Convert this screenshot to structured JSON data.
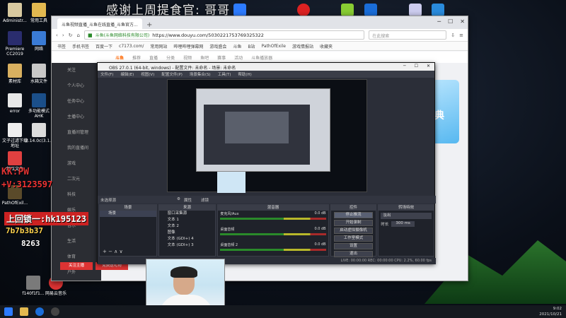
{
  "banner": "感谢上周提食官: 哥哥",
  "desktop": {
    "icons": [
      {
        "label": "Administr...",
        "color": "#d8c9a0"
      },
      {
        "label": "常用工具",
        "color": "#e3b950"
      },
      {
        "label": "Premiere CC2019",
        "color": "#2a2d6e"
      },
      {
        "label": "网络",
        "color": "#3a7bd5"
      },
      {
        "label": "素材库",
        "color": "#d8b060"
      },
      {
        "label": "水箱文件",
        "color": "#c8c8c8"
      },
      {
        "label": "error",
        "color": "#e8e8e8"
      },
      {
        "label": "多功能模式AHK",
        "color": "#1b4f8a"
      },
      {
        "label": "文子过滤下载地址",
        "color": "#eeeeee"
      },
      {
        "label": "3.14.0c(3.1...",
        "color": "#dcdcdc"
      },
      {
        "label": "解压文件",
        "color": "#e04040"
      },
      {
        "label": "PathOfExil...",
        "color": "#5a4a2a"
      },
      {
        "label": "f140f1f1...",
        "color": "#7a7a7a"
      },
      {
        "label": "网易云音乐",
        "color": "#d33"
      }
    ]
  },
  "overlay": {
    "kk": "KK:PW",
    "qq": "+V:3123597",
    "red_title": "上回锁一:hk195123",
    "phone": "7b7b3b37",
    "code": "8263"
  },
  "browser": {
    "tab_title": "斗鱼视频直播_斗鱼在线直播_斗鱼官方...",
    "url_host": "斗鱼(斗鱼网络科技有限公司)",
    "url": "https://www.douyu.com/5030221753769325322",
    "search_placeholder": "在此搜索",
    "bookmarks": [
      "书签",
      "手机书签",
      "百度一下",
      "c7173.com/",
      "常用网站",
      "哔哩哔哩弹幕网",
      "游戏盛会",
      "斗鱼",
      "B站",
      "PathOfExile",
      "游戏情报站",
      "收藏夹"
    ],
    "site_nav": [
      "推荐",
      "直播",
      "分类",
      "视频",
      "鱼吧",
      "赛事",
      "活动",
      "斗鱼播放器"
    ],
    "side_menu": [
      "关注",
      "个人中心",
      "任务中心",
      "主播中心",
      "直播间管理",
      "我的直播间",
      "游戏",
      "二次元",
      "科技",
      "娱乐",
      "音乐",
      "生活",
      "体育",
      "户外",
      "美食"
    ],
    "promo": "盛典",
    "btn1": "关注主播",
    "btn2": "免费送礼物"
  },
  "obs": {
    "title": "OBS 27.0.1 (64-bit, windows) - 配置文件: 未命名 - 场景: 未命名",
    "menu": [
      "文件(F)",
      "编辑(E)",
      "视图(V)",
      "配置文件(P)",
      "场景集合(S)",
      "工具(T)",
      "帮助(H)"
    ],
    "no_source": "未选择源",
    "properties": "属性",
    "filters": "滤镜",
    "panels": {
      "scenes": "场景",
      "sources": "来源",
      "mixer": "混音器",
      "transitions": "转场特效",
      "controls": "控件"
    },
    "scene_items": [
      "场景"
    ],
    "source_items": [
      "窗口采集源",
      "文本 1",
      "文本 2",
      "图像",
      "文本 (GDI+) 4",
      "文本 (GDI+) 3"
    ],
    "mixer_items": [
      {
        "name": "麦克风/Aux",
        "db": "0.0 dB"
      },
      {
        "name": "桌面音频",
        "db": "0.0 dB"
      },
      {
        "name": "桌面音频 2",
        "db": "0.0 dB"
      }
    ],
    "transition_type": "淡出",
    "duration_label": "时长",
    "duration_value": "300 ms",
    "controls": [
      "停止推流",
      "开始录制",
      "启动虚拟摄像机",
      "工作室模式",
      "设置",
      "退出"
    ],
    "status": "LIVE: 00:00:00   REC: 00:00:00   CPU: 2.2%, 60.00 fps"
  },
  "taskbar": {
    "time": "9:02",
    "date": "2021/10/21"
  }
}
